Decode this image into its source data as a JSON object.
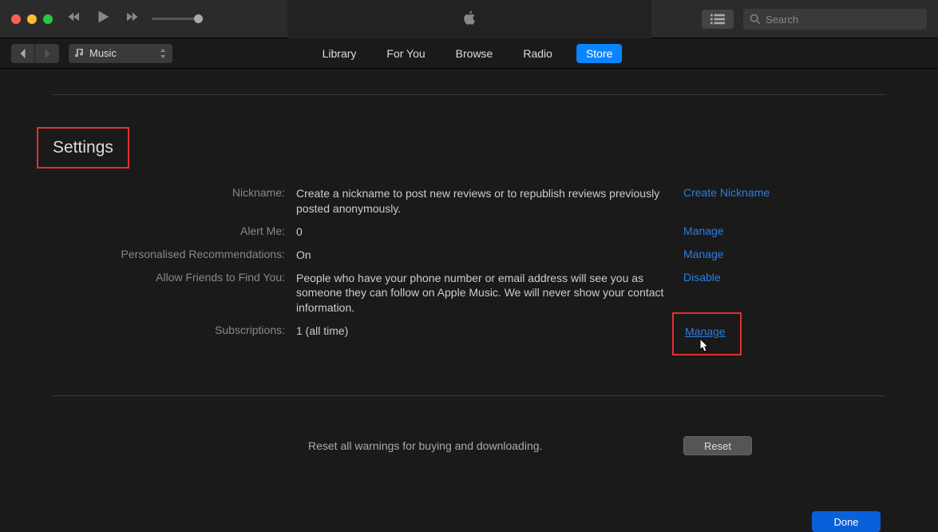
{
  "search": {
    "placeholder": "Search"
  },
  "mediaSelector": {
    "label": "Music"
  },
  "tabs": {
    "library": "Library",
    "forYou": "For You",
    "browse": "Browse",
    "radio": "Radio",
    "store": "Store"
  },
  "settings": {
    "title": "Settings",
    "rows": {
      "nickname": {
        "label": "Nickname:",
        "value": "Create a nickname to post new reviews or to republish reviews previously posted anonymously.",
        "action": "Create Nickname"
      },
      "alert": {
        "label": "Alert Me:",
        "value": "0",
        "action": "Manage"
      },
      "recs": {
        "label": "Personalised Recommendations:",
        "value": "On",
        "action": "Manage"
      },
      "friends": {
        "label": "Allow Friends to Find You:",
        "value": "People who have your phone number or email address will see you as someone they can follow on Apple Music. We will never show your contact information.",
        "action": "Disable"
      },
      "subs": {
        "label": "Subscriptions:",
        "value": "1 (all time)",
        "action": "Manage"
      }
    },
    "reset": {
      "text": "Reset all warnings for buying and downloading.",
      "button": "Reset"
    },
    "done": "Done"
  }
}
